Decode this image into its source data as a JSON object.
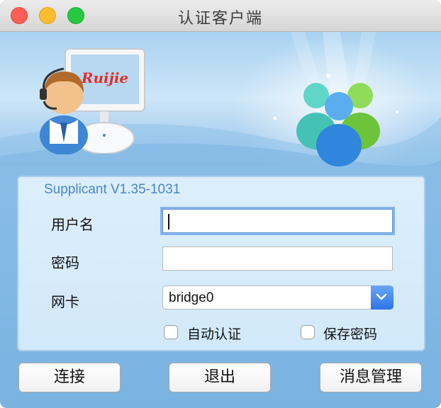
{
  "window": {
    "title": "认证客户端"
  },
  "banner": {
    "logo_text": "Ruijie"
  },
  "form": {
    "version": "Supplicant V1.35-1031",
    "username_label": "用户名",
    "username_value": "",
    "password_label": "密码",
    "password_value": "",
    "nic_label": "网卡",
    "nic_value": "bridge0",
    "auto_auth_label": "自动认证",
    "auto_auth_checked": false,
    "save_password_label": "保存密码",
    "save_password_checked": false
  },
  "buttons": {
    "connect": "连接",
    "exit": "退出",
    "messages": "消息管理"
  },
  "colors": {
    "accent": "#2d74e8",
    "background": "#7fb6e2",
    "version_text": "#4b86c4"
  }
}
